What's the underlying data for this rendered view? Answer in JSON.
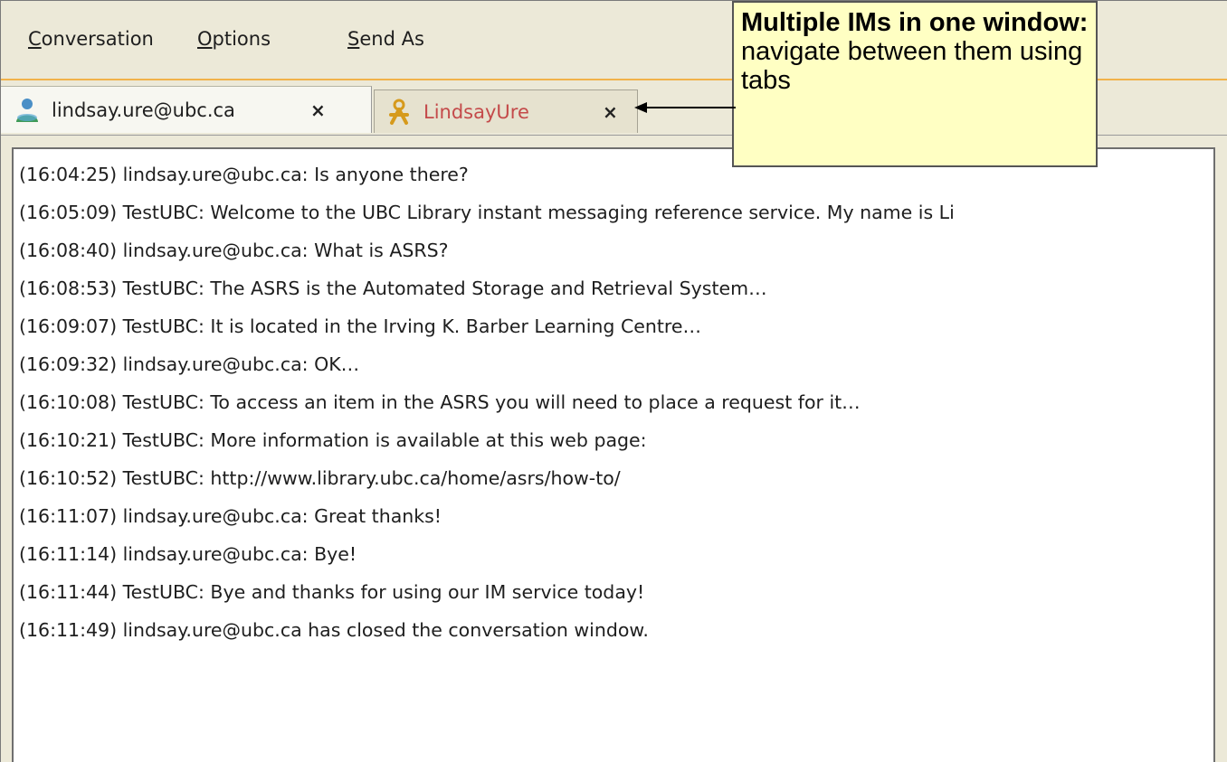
{
  "menu": {
    "conversation": {
      "mnemonic": "C",
      "rest": "onversation"
    },
    "options": {
      "mnemonic": "O",
      "rest": "ptions"
    },
    "send_as": {
      "mnemonic": "S",
      "rest": "end As"
    }
  },
  "tabs": [
    {
      "label": "lindsay.ure@ubc.ca",
      "icon": "buddy-online-icon",
      "close": "×"
    },
    {
      "label": "LindsayUre",
      "icon": "buddy-away-icon",
      "close": "×"
    }
  ],
  "callout": {
    "title": "Multiple IMs in one window:",
    "body": " navigate between them using tabs"
  },
  "messages": [
    "(16:04:25) lindsay.ure@ubc.ca: Is anyone there?",
    "(16:05:09) TestUBC: Welcome to the UBC Library instant messaging reference service. My name is Li",
    "(16:08:40) lindsay.ure@ubc.ca: What is ASRS?",
    "(16:08:53) TestUBC: The ASRS is the Automated Storage and Retrieval System…",
    "(16:09:07) TestUBC: It is located in the Irving K. Barber Learning Centre…",
    "(16:09:32) lindsay.ure@ubc.ca: OK…",
    "(16:10:08) TestUBC: To access an item in the ASRS you will need to place a request for it…",
    "(16:10:21) TestUBC: More information is available at this web page:",
    "(16:10:52) TestUBC: http://www.library.ubc.ca/home/asrs/how-to/",
    "(16:11:07) lindsay.ure@ubc.ca: Great thanks!",
    "(16:11:14) lindsay.ure@ubc.ca: Bye!",
    "(16:11:44) TestUBC: Bye and thanks for using our IM service today!",
    "(16:11:49) lindsay.ure@ubc.ca has closed the conversation window."
  ],
  "colors": {
    "active_tab_label": "#1e1e1e",
    "inactive_tab_label": "#c44a4a",
    "callout_bg": "#ffffc3",
    "menubar_accent": "#f1b24a"
  }
}
